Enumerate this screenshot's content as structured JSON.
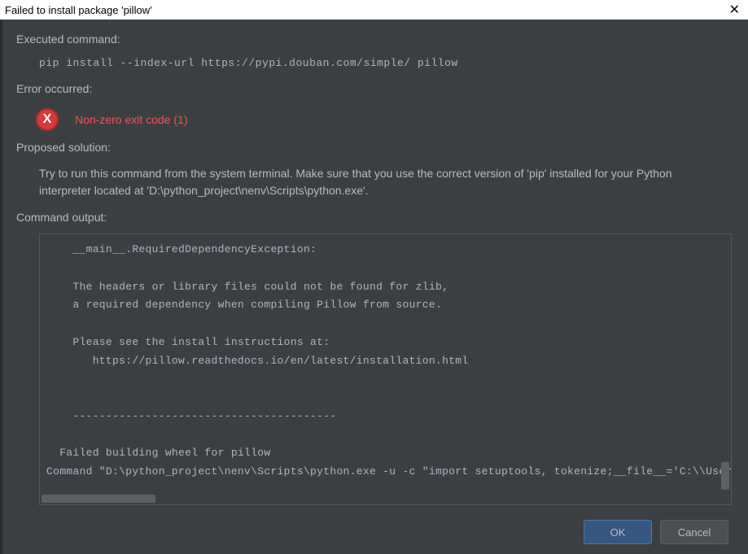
{
  "title": "Failed to install package 'pillow'",
  "sections": {
    "executed_label": "Executed command:",
    "executed_command": "pip install --index-url https://pypi.douban.com/simple/ pillow",
    "error_label": "Error occurred:",
    "error_message": "Non-zero exit code (1)",
    "error_icon_glyph": "X",
    "proposed_label": "Proposed solution:",
    "proposed_text": "Try to run this command from the system terminal. Make sure that you use the correct version of 'pip' installed for your Python interpreter located at 'D:\\python_project\\nenv\\Scripts\\python.exe'.",
    "output_label": "Command output:",
    "output_text": "    __main__.RequiredDependencyException:\n\n    The headers or library files could not be found for zlib,\n    a required dependency when compiling Pillow from source.\n\n    Please see the install instructions at:\n       https://pillow.readthedocs.io/en/latest/installation.html\n\n\n    ----------------------------------------\n\n  Failed building wheel for pillow\nCommand \"D:\\python_project\\nenv\\Scripts\\python.exe -u -c \"import setuptools, tokenize;__file__='C:\\\\Users\\"
  },
  "buttons": {
    "ok": "OK",
    "cancel": "Cancel"
  }
}
